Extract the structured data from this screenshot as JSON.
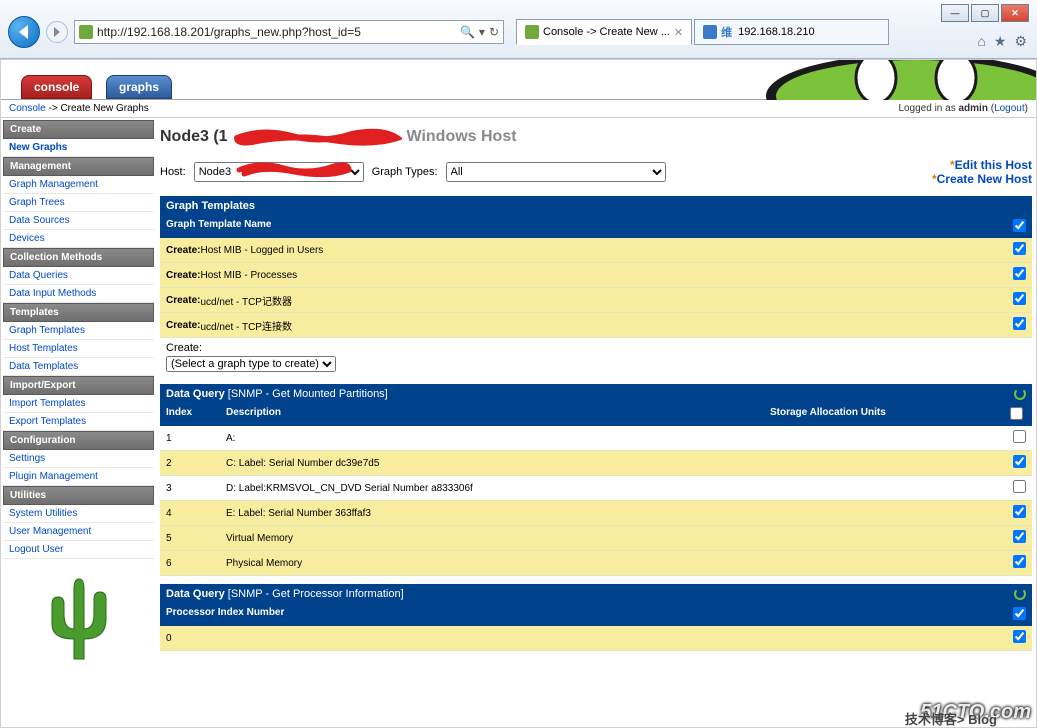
{
  "browser": {
    "url": "http://192.168.18.201/graphs_new.php?host_id=5",
    "tabs": [
      {
        "label": "Console -> Create New ..."
      },
      {
        "label": "192.168.18.210"
      }
    ]
  },
  "app_tabs": {
    "console": "console",
    "graphs": "graphs"
  },
  "breadcrumb": {
    "console": "Console",
    "arrow": "->",
    "current": "Create New Graphs"
  },
  "login": {
    "prefix": "Logged in as ",
    "user": "admin",
    "logout": "Logout"
  },
  "sidebar": {
    "create": "Create",
    "new_graphs": "New Graphs",
    "management": "Management",
    "graph_management": "Graph Management",
    "graph_trees": "Graph Trees",
    "data_sources": "Data Sources",
    "devices": "Devices",
    "collection_methods": "Collection Methods",
    "data_queries": "Data Queries",
    "data_input_methods": "Data Input Methods",
    "templates": "Templates",
    "graph_templates": "Graph Templates",
    "host_templates": "Host Templates",
    "data_templates": "Data Templates",
    "import_export": "Import/Export",
    "import_templates": "Import Templates",
    "export_templates": "Export Templates",
    "configuration": "Configuration",
    "settings": "Settings",
    "plugin_management": "Plugin Management",
    "utilities": "Utilities",
    "system_utilities": "System Utilities",
    "user_management": "User Management",
    "logout_user": "Logout User"
  },
  "title": {
    "node": "Node3 (1",
    "hosttype": " Windows Host"
  },
  "host_row": {
    "host_label": "Host:",
    "host_value": "Node3",
    "graph_types_label": "Graph Types:",
    "graph_types_value": "All",
    "edit_host": "Edit this Host",
    "create_host": "Create New Host"
  },
  "graph_templates": {
    "header": "Graph Templates",
    "col_name": "Graph Template Name",
    "rows": [
      {
        "prefix": "Create:",
        "text": " Host MIB - Logged in Users",
        "checked": true
      },
      {
        "prefix": "Create:",
        "text": " Host MIB - Processes",
        "checked": true
      },
      {
        "prefix": "Create:",
        "text": " ucd/net - TCP记数器",
        "checked": true
      },
      {
        "prefix": "Create:",
        "text": " ucd/net - TCP连接数",
        "checked": true
      }
    ],
    "create_label": "Create:",
    "create_select": "(Select a graph type to create)"
  },
  "dq1": {
    "header_prefix": "Data Query ",
    "header_sub": "[SNMP - Get Mounted Partitions]",
    "col_index": "Index",
    "col_desc": "Description",
    "col_sau": "Storage Allocation Units",
    "rows": [
      {
        "index": "1",
        "desc": "A:",
        "checked": false,
        "sel": false
      },
      {
        "index": "2",
        "desc": "C: Label: Serial Number dc39e7d5",
        "checked": true,
        "sel": true
      },
      {
        "index": "3",
        "desc": "D: Label:KRMSVOL_CN_DVD Serial Number a833306f",
        "checked": false,
        "sel": false
      },
      {
        "index": "4",
        "desc": "E: Label: Serial Number 363ffaf3",
        "checked": true,
        "sel": true
      },
      {
        "index": "5",
        "desc": "Virtual Memory",
        "checked": true,
        "sel": true
      },
      {
        "index": "6",
        "desc": "Physical Memory",
        "checked": true,
        "sel": true
      }
    ]
  },
  "dq2": {
    "header_prefix": "Data Query ",
    "header_sub": "[SNMP - Get Processor Information]",
    "col": "Processor Index Number",
    "rows": [
      {
        "index": "0",
        "checked": true
      }
    ]
  },
  "watermark": {
    "text": "51CTO.com",
    "cn": "技术博客> Blog"
  }
}
